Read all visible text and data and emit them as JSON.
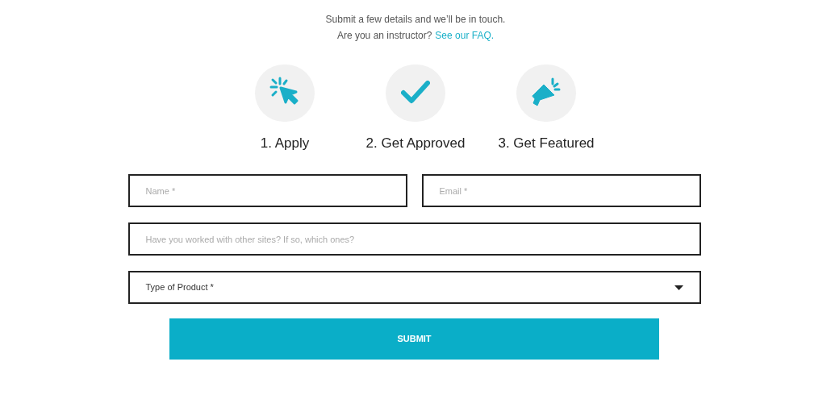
{
  "intro": {
    "line": "Submit a few details and we’ll be in touch.",
    "question": "Are you an instructor?",
    "link": "See our FAQ."
  },
  "steps": [
    {
      "kind": "cursor",
      "label": "1. Apply"
    },
    {
      "kind": "check",
      "label": "2. Get Approved"
    },
    {
      "kind": "megaphone",
      "label": "3. Get Featured"
    }
  ],
  "form": {
    "name": {
      "placeholder": "Name *"
    },
    "email": {
      "placeholder": "Email *"
    },
    "sites": {
      "placeholder": "Have you worked with other sites? If so, which ones?"
    },
    "product": {
      "value": "Type of Product *"
    },
    "submit": "SUBMIT"
  }
}
